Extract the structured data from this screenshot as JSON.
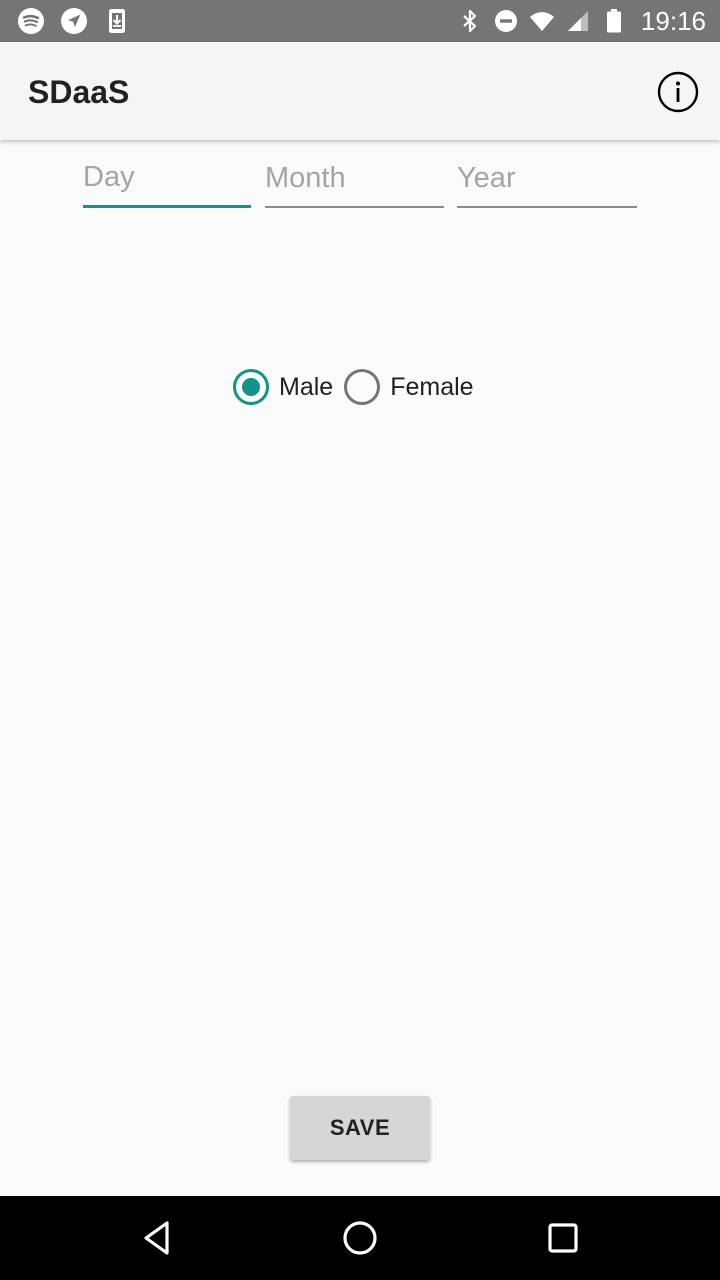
{
  "status_bar": {
    "time": "19:16",
    "left_icons": [
      "spotify-icon",
      "navigation-icon",
      "download-icon"
    ],
    "right_icons": [
      "bluetooth-icon",
      "do-not-disturb-icon",
      "wifi-icon",
      "signal-icon",
      "battery-icon"
    ]
  },
  "app_bar": {
    "title": "SDaaS",
    "info_icon": "info-icon"
  },
  "date_fields": {
    "day": {
      "placeholder": "Day",
      "value": "",
      "focused": true
    },
    "month": {
      "placeholder": "Month",
      "value": ""
    },
    "year": {
      "placeholder": "Year",
      "value": ""
    }
  },
  "gender": {
    "options": [
      {
        "label": "Male",
        "selected": true
      },
      {
        "label": "Female",
        "selected": false
      }
    ]
  },
  "save_button": {
    "label": "SAVE"
  },
  "nav_bar": {
    "icons": [
      "back-icon",
      "home-icon",
      "recents-icon"
    ]
  },
  "colors": {
    "accent": "#139486",
    "status_bar": "#757575",
    "app_bar": "#f5f5f5",
    "background": "#fafafa",
    "nav_bar": "#000000"
  }
}
